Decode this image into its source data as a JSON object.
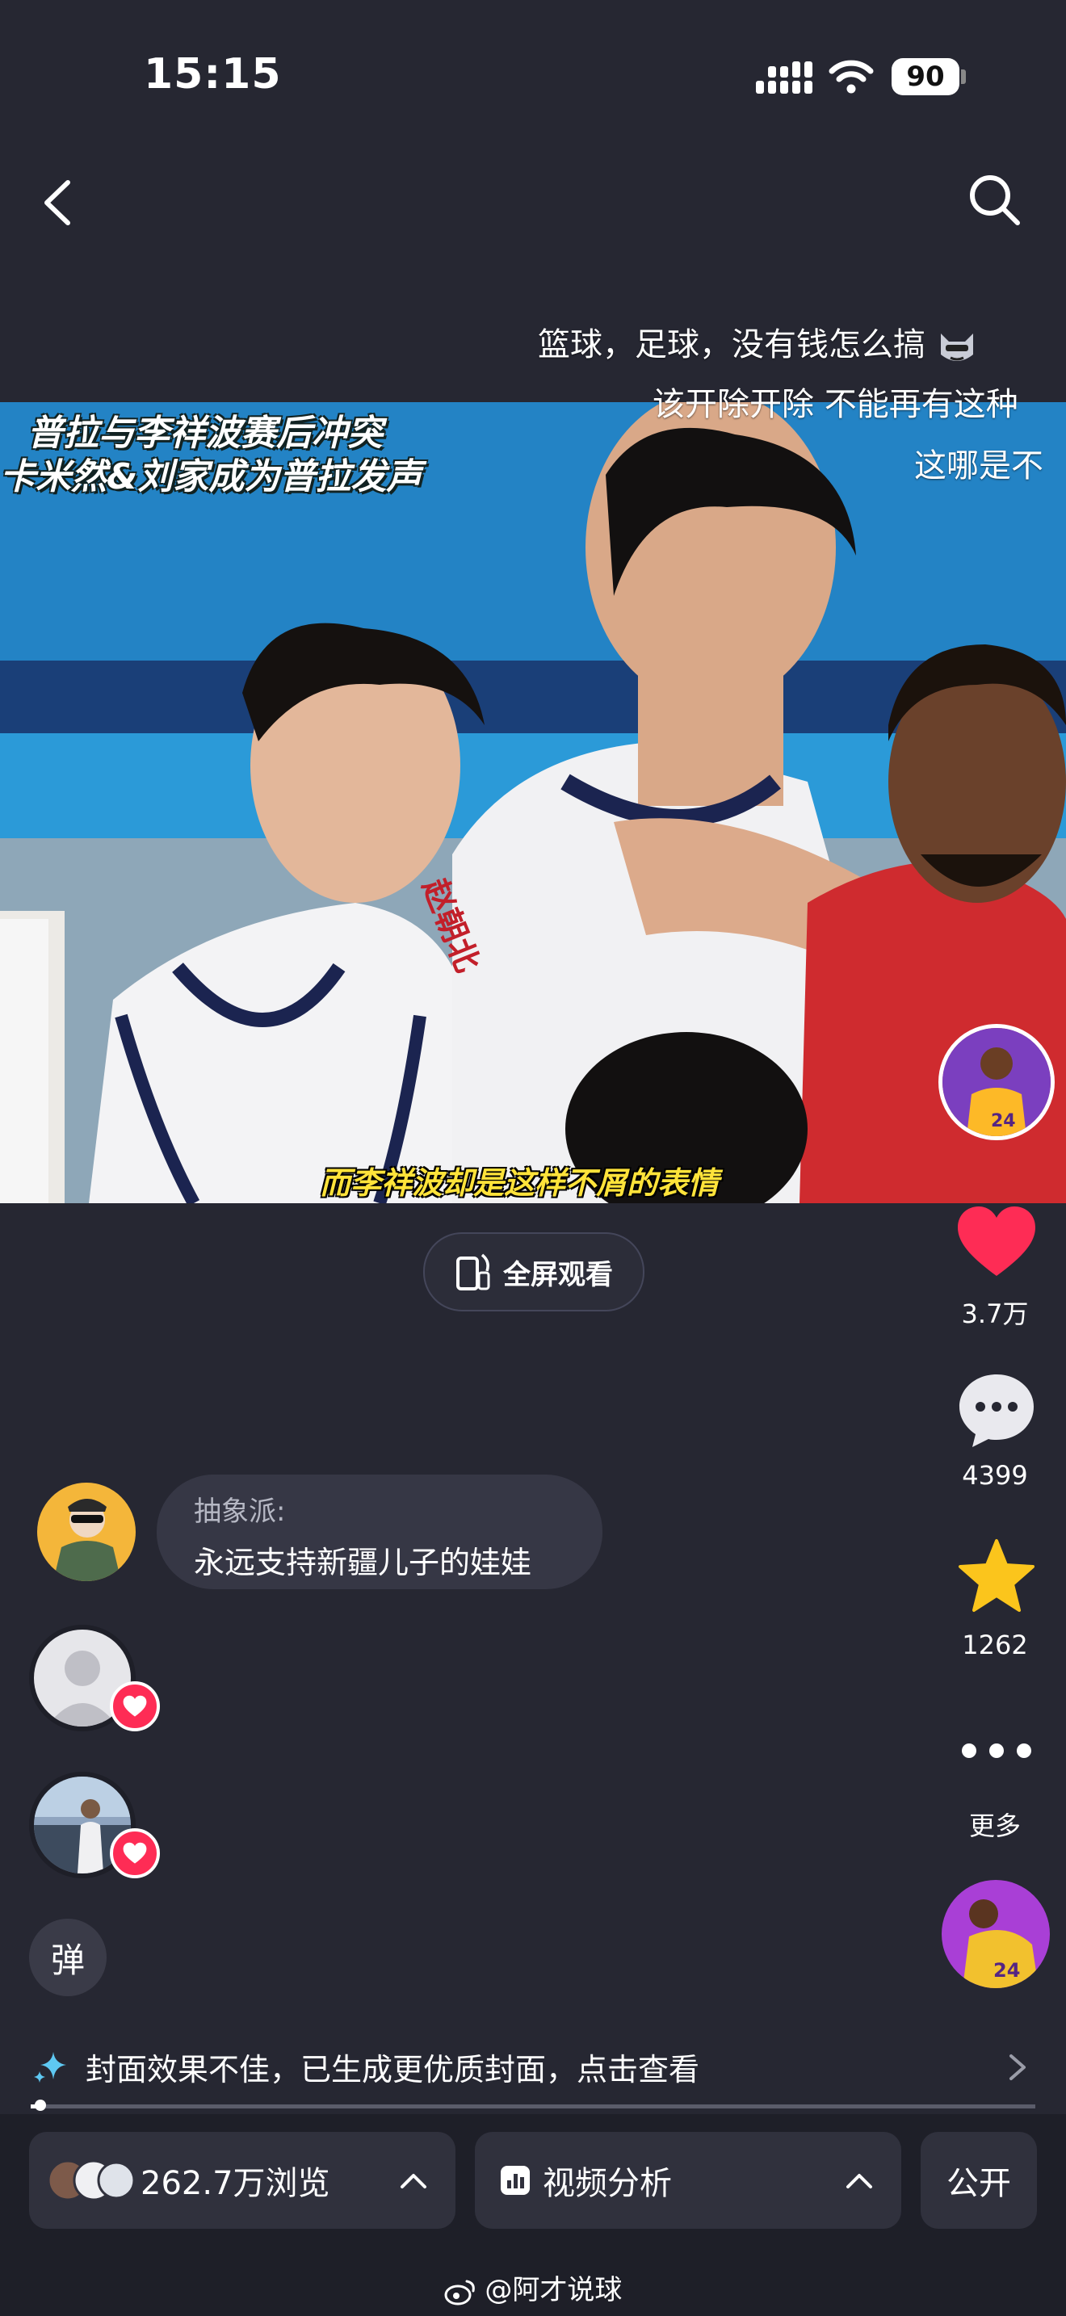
{
  "status_bar": {
    "time": "15:15",
    "battery": "90"
  },
  "danmu": [
    "篮球，足球，没有钱怎么搞",
    "该开除开除 不能再有这种",
    "这哪是不"
  ],
  "video": {
    "title_line1": "普拉与李祥波赛后冲突",
    "title_line2": "卡米然&刘家成为普拉发声",
    "jersey_text": "赵朝北",
    "subtitle": "而李祥波却是这样不屑的表情"
  },
  "fullscreen_label": "全屏观看",
  "actions": {
    "likes": "3.7万",
    "comments": "4399",
    "favorites": "1262",
    "more": "更多"
  },
  "comment": {
    "user": "抽象派:",
    "text": "永远支持新疆儿子的娃娃"
  },
  "danmu_toggle": "弹",
  "notice": "封面效果不佳，已生成更优质封面，点击查看",
  "progress": 0.01,
  "bottom": {
    "views": "262.7万浏览",
    "analysis": "视频分析",
    "public": "公开"
  },
  "watermark": "@阿才说球",
  "colors": {
    "background": "#262732",
    "like": "#fe2c55",
    "star": "#fbc51c",
    "subtitle": "#ffe33a"
  }
}
